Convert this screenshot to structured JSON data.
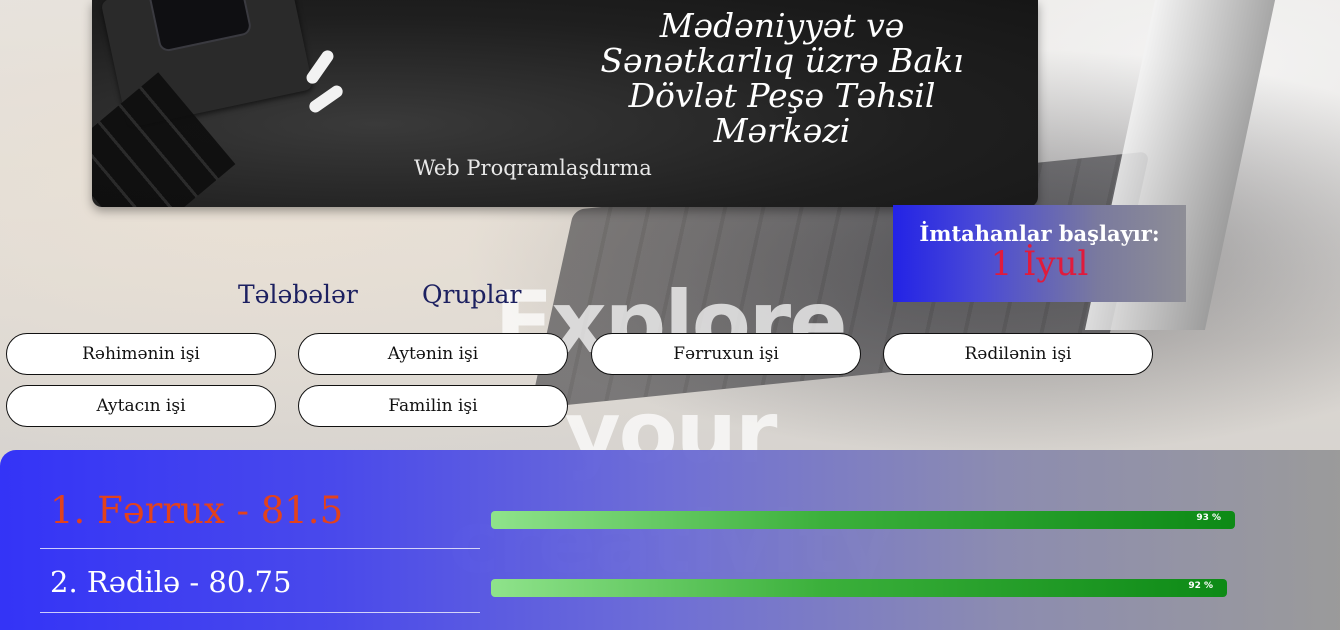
{
  "header": {
    "title": "Mədəniyyət və Sənətkarlıq üzrə Bakı Dövlət Peşə Təhsil Mərkəzi",
    "subtitle": "Web Proqramlaşdırma"
  },
  "background": {
    "text": "Explore your creativity"
  },
  "exam": {
    "label": "İmtahanlar başlayır:",
    "date": "1 İyul",
    "date_color": "#e01b3c"
  },
  "nav": {
    "items": [
      {
        "label": "Tələbələr"
      },
      {
        "label": "Qruplar"
      }
    ]
  },
  "students": {
    "buttons": [
      {
        "label": "Rəhimənin işi"
      },
      {
        "label": "Aytənin işi"
      },
      {
        "label": "Fərruxun işi"
      },
      {
        "label": "Rədilənin işi"
      },
      {
        "label": "Aytacın işi"
      },
      {
        "label": "Familin işi"
      }
    ]
  },
  "ranking": {
    "accent_first": "#e2421c",
    "entries": [
      {
        "text": "1. Fərrux - 81.5",
        "progress": 0.93,
        "progress_label": "93 %"
      },
      {
        "text": "2. Rədilə - 80.75",
        "progress": 0.92,
        "progress_label": "92 %"
      }
    ]
  },
  "colors": {
    "panel_gradient_start": "#2f2ff8",
    "nav_text": "#1c2060",
    "bar_green": "#0d8a16"
  }
}
